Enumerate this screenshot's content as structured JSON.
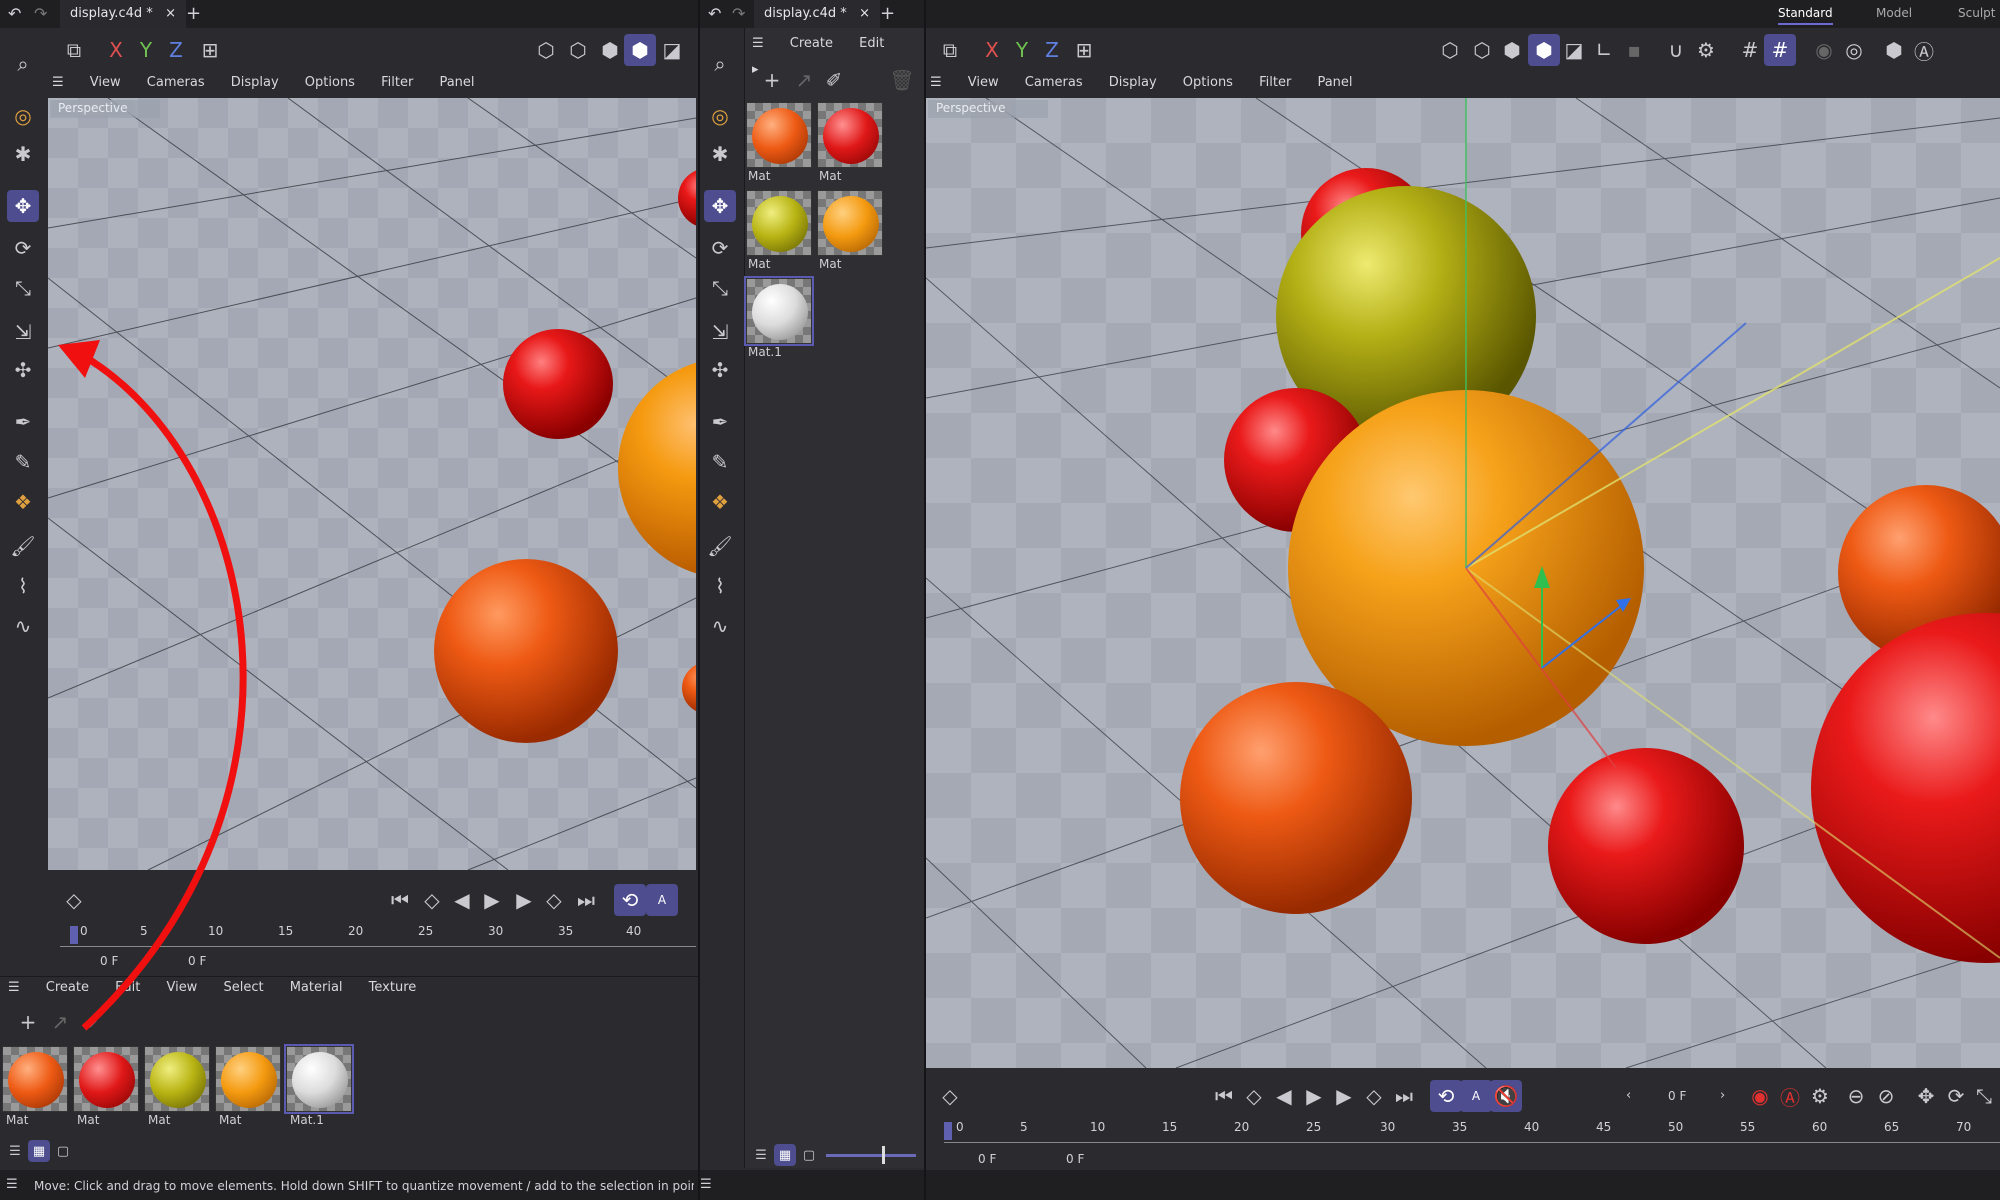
{
  "left_window": {
    "tab_title": "display.c4d *",
    "axis_buttons": [
      "X",
      "Y",
      "Z"
    ],
    "viewport_menu": [
      "View",
      "Cameras",
      "Display",
      "Options",
      "Filter",
      "Panel"
    ],
    "viewport_label": "Perspective",
    "frame_field": "0 F",
    "frame_field_2": "0 F",
    "timeline_ticks": [
      "0",
      "5",
      "10",
      "15",
      "20",
      "25",
      "30",
      "35",
      "40"
    ],
    "material_menu": [
      "Create",
      "Edit",
      "View",
      "Select",
      "Material",
      "Texture"
    ],
    "materials": [
      {
        "label": "Mat",
        "color": "#ee5a14"
      },
      {
        "label": "Mat",
        "color": "#e01818"
      },
      {
        "label": "Mat",
        "color": "#b8b414"
      },
      {
        "label": "Mat",
        "color": "#f49a10"
      },
      {
        "label": "Mat.1",
        "color": "#dcdcdc"
      }
    ],
    "status_text": "Move: Click and drag to move elements. Hold down SHIFT to quantize movement / add to the selection in point mo"
  },
  "middle_window": {
    "tab_title": "display.c4d *",
    "menu": [
      "Create",
      "Edit"
    ],
    "materials": [
      {
        "label": "Mat",
        "color": "#ee5a14"
      },
      {
        "label": "Mat",
        "color": "#e01818"
      },
      {
        "label": "Mat",
        "color": "#b8b414"
      },
      {
        "label": "Mat",
        "color": "#f49a10"
      },
      {
        "label": "Mat.1",
        "color": "#dcdcdc"
      }
    ]
  },
  "right_window": {
    "layout_tabs": [
      "Standard",
      "Model",
      "Sculpt"
    ],
    "active_layout": "Standard",
    "axis_buttons": [
      "X",
      "Y",
      "Z"
    ],
    "viewport_menu": [
      "View",
      "Cameras",
      "Display",
      "Options",
      "Filter",
      "Panel"
    ],
    "viewport_label": "Perspective",
    "current_frame": "0 F",
    "frame_field": "0 F",
    "frame_field_2": "0 F",
    "timeline_ticks": [
      "0",
      "5",
      "10",
      "15",
      "20",
      "25",
      "30",
      "35",
      "40",
      "45",
      "50",
      "55",
      "60",
      "65",
      "70"
    ]
  },
  "colors": {
    "accent": "#4d4d8f",
    "annotation_arrow": "#f01010"
  }
}
